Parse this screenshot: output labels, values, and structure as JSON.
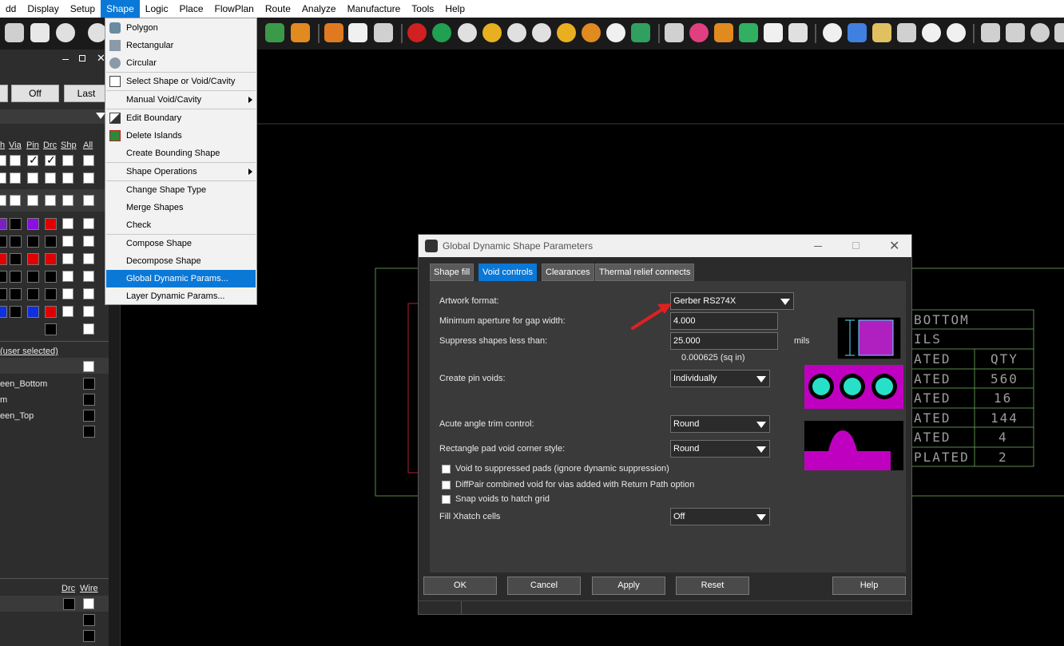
{
  "menubar": {
    "items": [
      "dd",
      "Display",
      "Setup",
      "Shape",
      "Logic",
      "Place",
      "FlowPlan",
      "Route",
      "Analyze",
      "Manufacture",
      "Tools",
      "Help"
    ],
    "active_index": 3
  },
  "left_panel": {
    "buttons": {
      "off": "Off",
      "last": "Last"
    },
    "column_headers": [
      "h",
      "Via",
      "Pin",
      "Drc",
      "Shp",
      "All"
    ],
    "user_selected_label": "(user selected)",
    "layers": [
      "een_Bottom",
      "m",
      "een_Top"
    ],
    "bottom_headers": [
      "Drc",
      "Wire"
    ]
  },
  "shape_menu": {
    "items": [
      {
        "label": "Polygon",
        "icon": "polygon-icon",
        "submenu": false
      },
      {
        "label": "Rectangular",
        "icon": "rectangle-icon",
        "submenu": false
      },
      {
        "label": "Circular",
        "icon": "circle-icon",
        "submenu": false
      },
      {
        "label": "Select Shape or Void/Cavity",
        "icon": "select-shape-icon",
        "submenu": false
      },
      {
        "label": "Manual Void/Cavity",
        "icon": "",
        "submenu": true
      },
      {
        "label": "Edit Boundary",
        "icon": "edit-boundary-icon",
        "submenu": false
      },
      {
        "label": "Delete Islands",
        "icon": "delete-islands-icon",
        "submenu": false
      },
      {
        "label": "Create Bounding Shape",
        "icon": "",
        "submenu": false
      },
      {
        "label": "Shape Operations",
        "icon": "",
        "submenu": true
      },
      {
        "label": "Change Shape Type",
        "icon": "",
        "submenu": false
      },
      {
        "label": "Merge Shapes",
        "icon": "",
        "submenu": false
      },
      {
        "label": "Check",
        "icon": "",
        "submenu": false
      },
      {
        "label": "Compose Shape",
        "icon": "",
        "submenu": false
      },
      {
        "label": "Decompose Shape",
        "icon": "",
        "submenu": false
      },
      {
        "label": "Global Dynamic Params...",
        "icon": "",
        "submenu": false
      },
      {
        "label": "Layer Dynamic Params...",
        "icon": "",
        "submenu": false
      }
    ],
    "highlighted": "Global Dynamic Params..."
  },
  "canvas": {
    "table": {
      "title": "BOTTOM",
      "subtitle": "ILS",
      "rows": [
        {
          "label": "ATED",
          "qty": "QTY"
        },
        {
          "label": "ATED",
          "qty": "560"
        },
        {
          "label": "ATED",
          "qty": "16"
        },
        {
          "label": "ATED",
          "qty": "144"
        },
        {
          "label": "ATED",
          "qty": "4"
        },
        {
          "label": "PLATED",
          "qty": "2"
        }
      ]
    }
  },
  "dialog": {
    "title": "Global Dynamic Shape Parameters",
    "tabs": [
      "Shape fill",
      "Void controls",
      "Clearances",
      "Thermal relief connects"
    ],
    "active_tab": "Void controls",
    "fields": {
      "artwork_format": {
        "label": "Artwork format:",
        "value": "Gerber RS274X"
      },
      "min_aperture": {
        "label": "Minimum aperture for gap width:",
        "value": "4.000"
      },
      "suppress_shapes": {
        "label": "Suppress shapes less than:",
        "value": "25.000",
        "unit": "mils",
        "sq_in": "0.000625 (sq in)"
      },
      "create_pin_voids": {
        "label": "Create pin voids:",
        "value": "Individually"
      },
      "acute_angle": {
        "label": "Acute angle trim control:",
        "value": "Round"
      },
      "rect_pad_corner": {
        "label": "Rectangle pad void corner style:",
        "value": "Round"
      },
      "fill_xhatch": {
        "label": "Fill Xhatch cells",
        "value": "Off"
      }
    },
    "checkboxes": [
      {
        "label": "Void to suppressed pads (ignore dynamic suppression)",
        "checked": false
      },
      {
        "label": "DiffPair combined void for vias added with Return Path option",
        "checked": false
      },
      {
        "label": "Snap voids to hatch grid",
        "checked": false
      }
    ],
    "buttons": [
      "OK",
      "Cancel",
      "Apply",
      "Reset",
      "Help"
    ]
  },
  "colors": {
    "accent": "#0a78d7",
    "magenta": "#c000c0",
    "cyan": "#27e0c8",
    "annotation_arrow": "#e02020",
    "board_outline": "#5a8a4a"
  }
}
